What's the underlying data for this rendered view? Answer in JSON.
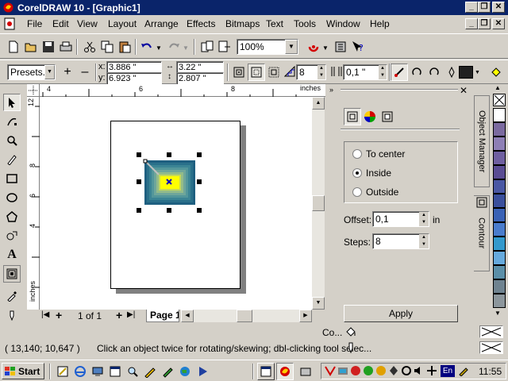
{
  "window": {
    "title": "CorelDRAW 10 - [Graphic1]"
  },
  "menu": [
    "File",
    "Edit",
    "View",
    "Layout",
    "Arrange",
    "Effects",
    "Bitmaps",
    "Text",
    "Tools",
    "Window",
    "Help"
  ],
  "standard_toolbar": {
    "zoom": "100%"
  },
  "property_bar": {
    "presets": "Presets...",
    "x_label": "x:",
    "x_value": "3.886 \"",
    "y_label": "y:",
    "y_value": "6.923 \"",
    "width_value": "3.22 \"",
    "height_value": "2.807 \"",
    "steps_value": "8",
    "offset_value": "0,1 \""
  },
  "rulers": {
    "unit": "inches",
    "top_ticks": [
      "4",
      "6",
      "8"
    ],
    "left_ticks": [
      "12",
      "8",
      "6",
      "4"
    ]
  },
  "page_nav": {
    "page_count": "1 of 1",
    "page_tab": "Page 1"
  },
  "docker": {
    "tabs": [
      "Object Manager",
      "Contour"
    ],
    "options": [
      {
        "label": "To center",
        "selected": false
      },
      {
        "label": "Inside",
        "selected": true
      },
      {
        "label": "Outside",
        "selected": false
      }
    ],
    "offset_label": "Offset:",
    "offset_value": "0,1",
    "offset_unit": "in",
    "steps_label": "Steps:",
    "steps_value": "8",
    "apply_label": "Apply"
  },
  "palette_colors": [
    "#ffffff",
    "#7b6a9f",
    "#8e7fb5",
    "#6f5fa0",
    "#5a4c93",
    "#4a57a3",
    "#3a4f9c",
    "#3a62b5",
    "#4a7ccc",
    "#3399cc",
    "#66aadd",
    "#5b8fa8",
    "#6f8390",
    "#7a8790",
    "#8c969c"
  ],
  "status": {
    "coords": "( 13,140; 10,647 )",
    "hint": "Click an object twice for rotating/skewing; dbl-clicking tool selec...",
    "color_label": "Co..."
  },
  "taskbar": {
    "start": "Start",
    "lang": "En",
    "clock": "11:55"
  }
}
